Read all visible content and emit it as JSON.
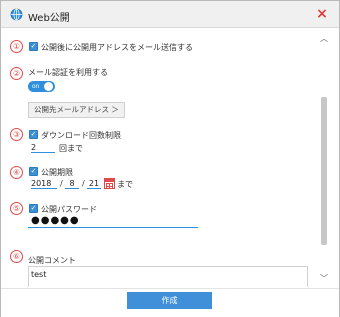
{
  "window": {
    "title": "Web公開",
    "close_glyph": "×"
  },
  "items": {
    "n1": "①",
    "n2": "②",
    "n3": "③",
    "n4": "④",
    "n5": "⑤",
    "n6": "⑥"
  },
  "send_address": {
    "checked": true,
    "label": "公開後に公開用アドレスをメール送信する"
  },
  "mail_auth": {
    "label": "メール認証を利用する",
    "toggle_text": "on",
    "toggle_on": true
  },
  "address_button": {
    "label": "公開先メールアドレス ＞"
  },
  "download_limit": {
    "checked": true,
    "label": "ダウンロード回数制限",
    "value": "2",
    "suffix": "回まで"
  },
  "period": {
    "checked": true,
    "label": "公開期限",
    "year": "2018",
    "sep1": "/",
    "month": "8",
    "sep2": "/",
    "day": "21",
    "suffix": "まで"
  },
  "password": {
    "checked": true,
    "label": "公開パスワード",
    "masked": "●●●●●"
  },
  "comment": {
    "label": "公開コメント",
    "text": "test"
  },
  "scroll": {
    "up": "︿",
    "down": "﹀"
  },
  "footer": {
    "create_label": "作成"
  },
  "colors": {
    "accent": "#3f8fd9",
    "number": "#e04a4a",
    "close": "#e03b3b"
  }
}
